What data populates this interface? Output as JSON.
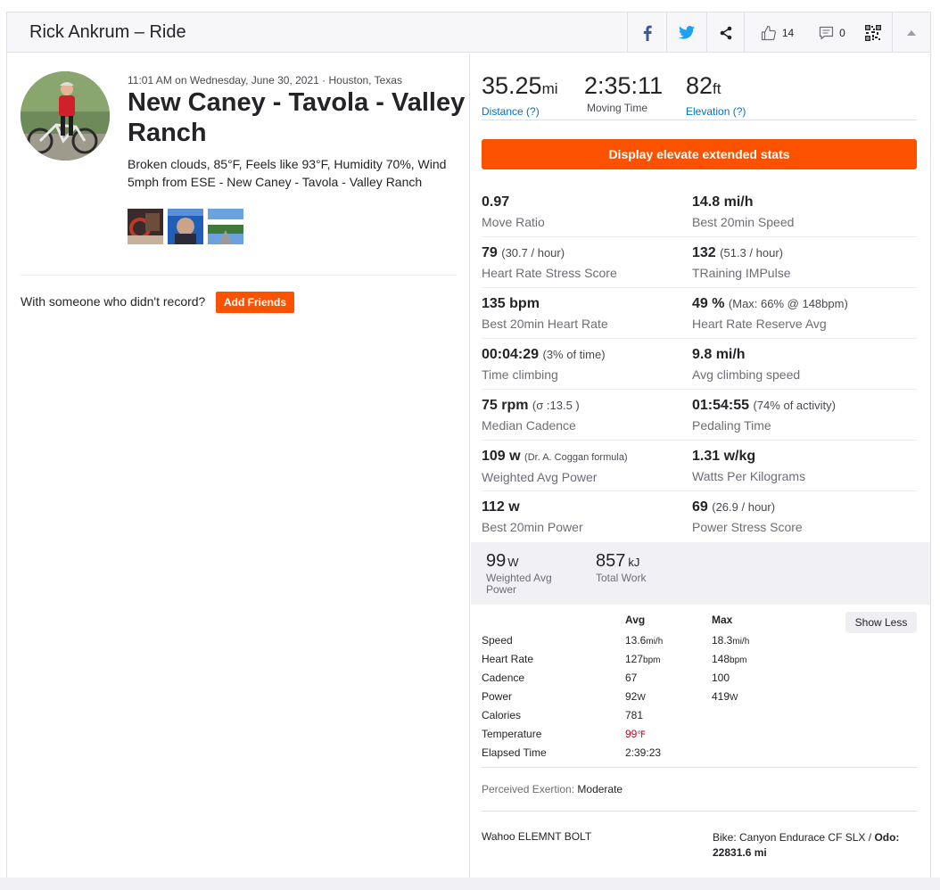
{
  "header": {
    "title": "Rick Ankrum – Ride",
    "kudos_count": "14",
    "comments_count": "0"
  },
  "activity": {
    "meta": "11:01 AM on Wednesday, June 30, 2021 · Houston, Texas",
    "title": "New Caney - Tavola - Valley Ranch",
    "description": "Broken clouds, 85°F, Feels like 93°F, Humidity 70%, Wind 5mph from ESE - New Caney - Tavola - Valley Ranch",
    "friends_prompt": "With someone who didn't record?",
    "add_friends_label": "Add Friends"
  },
  "summary": {
    "distance": {
      "value": "35.25",
      "unit": "mi",
      "label": "Distance (?)"
    },
    "moving_time": {
      "value": "2:35:11",
      "label": "Moving Time"
    },
    "elevation": {
      "value": "82",
      "unit": "ft",
      "label": "Elevation (?)"
    }
  },
  "extended_button_label": "Display elevate extended stats",
  "extended_stats": [
    {
      "left": {
        "value": "0.97",
        "sub": "",
        "label": "Move Ratio"
      },
      "right": {
        "value": "14.8 mi/h",
        "sub": "",
        "label": "Best 20min Speed"
      }
    },
    {
      "left": {
        "value": "79",
        "sub": "(30.7 / hour)",
        "label": "Heart Rate Stress Score"
      },
      "right": {
        "value": "132",
        "sub": "(51.3 / hour)",
        "label": "TRaining IMPulse"
      }
    },
    {
      "left": {
        "value": "135 bpm",
        "sub": "",
        "label": "Best 20min Heart Rate"
      },
      "right": {
        "value": "49 %",
        "sub": "(Max: 66% @ 148bpm)",
        "label": "Heart Rate Reserve Avg"
      }
    },
    {
      "left": {
        "value": "00:04:29",
        "sub": "(3% of time)",
        "label": "Time climbing"
      },
      "right": {
        "value": "9.8 mi/h",
        "sub": "",
        "label": "Avg climbing speed"
      }
    },
    {
      "left": {
        "value": "75 rpm",
        "sub": "(σ :13.5 )",
        "label": "Median Cadence"
      },
      "right": {
        "value": "01:54:55",
        "sub": "(74% of activity)",
        "label": "Pedaling Time"
      }
    },
    {
      "left": {
        "value": "109 w",
        "sub": "(Dr. A. Coggan formula)",
        "label": "Weighted Avg Power"
      },
      "right": {
        "value": "1.31 w/kg",
        "sub": "",
        "label": "Watts Per Kilograms"
      }
    },
    {
      "left": {
        "value": "112 w",
        "sub": "",
        "label": "Best 20min Power"
      },
      "right": {
        "value": "69",
        "sub": "(26.9 / hour)",
        "label": "Power Stress Score"
      }
    }
  ],
  "power_summary": {
    "weighted_avg": {
      "value": "99",
      "unit": "W",
      "label": "Weighted Avg Power"
    },
    "total_work": {
      "value": "857",
      "unit": "kJ",
      "label": "Total Work"
    }
  },
  "details_table": {
    "col_avg": "Avg",
    "col_max": "Max",
    "show_less_label": "Show Less",
    "rows": [
      {
        "name": "Speed",
        "avg": "13.6",
        "avg_unit": "mi/h",
        "max": "18.3",
        "max_unit": "mi/h"
      },
      {
        "name": "Heart Rate",
        "avg": "127",
        "avg_unit": "bpm",
        "max": "148",
        "max_unit": "bpm"
      },
      {
        "name": "Cadence",
        "avg": "67",
        "avg_unit": "",
        "max": "100",
        "max_unit": ""
      },
      {
        "name": "Power",
        "avg": "92",
        "avg_unit": "W",
        "max": "419",
        "max_unit": "W"
      },
      {
        "name": "Calories",
        "avg": "781",
        "avg_unit": "",
        "max": "",
        "max_unit": ""
      },
      {
        "name": "Temperature",
        "avg": "99",
        "avg_unit": "℉",
        "max": "",
        "max_unit": ""
      },
      {
        "name": "Elapsed Time",
        "avg": "2:39:23",
        "avg_unit": "",
        "max": "",
        "max_unit": ""
      }
    ]
  },
  "exertion": {
    "label": "Perceived Exertion:",
    "value": "Moderate"
  },
  "device": "Wahoo ELEMNT BOLT",
  "bike": {
    "text": "Bike: Canyon Endurace CF SLX / ",
    "odo_label": "Odo:",
    "odo_value": "22831.6 mi"
  },
  "colors": {
    "accent": "#fc5200",
    "link": "#0072c6",
    "facebook": "#3b5998",
    "twitter": "#1da1f2",
    "temperature": "#d0021b"
  }
}
